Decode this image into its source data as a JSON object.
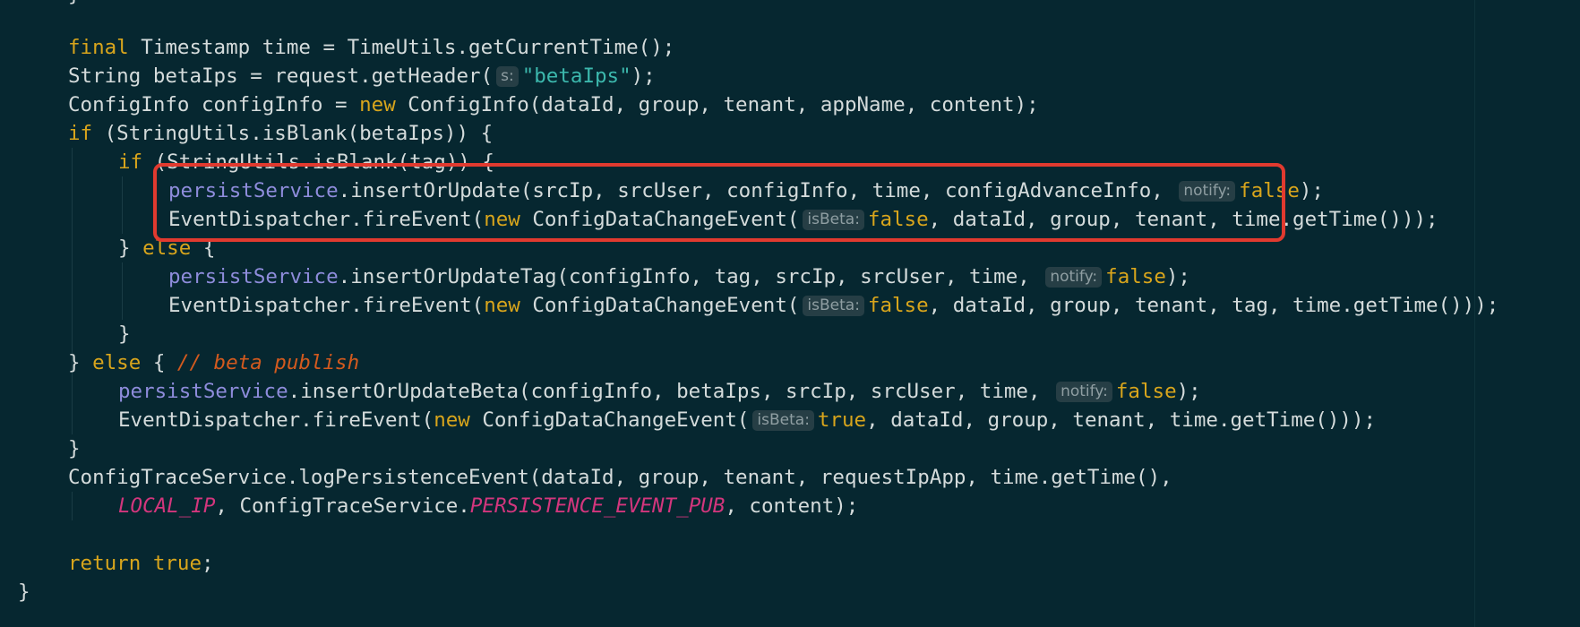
{
  "editor": {
    "top_fragment": "}",
    "lines": [
      {
        "tokens": [
          {
            "t": "final",
            "c": "kw"
          },
          {
            "t": " Timestamp time = TimeUtils.getCurrentTime();"
          }
        ]
      },
      {
        "tokens": [
          {
            "t": "String betaIps = request.getHeader("
          },
          {
            "t": "s:",
            "c": "hint"
          },
          {
            "t": "\"betaIps\"",
            "c": "str"
          },
          {
            "t": ");"
          }
        ]
      },
      {
        "tokens": [
          {
            "t": "ConfigInfo configInfo = "
          },
          {
            "t": "new",
            "c": "kw"
          },
          {
            "t": " ConfigInfo(dataId, group, tenant, appName, content);"
          }
        ]
      },
      {
        "tokens": [
          {
            "t": "if",
            "c": "kw"
          },
          {
            "t": " (StringUtils.isBlank(betaIps)) {"
          }
        ]
      },
      {
        "tokens": [
          {
            "t": "if",
            "c": "kw"
          },
          {
            "t": " (StringUtils.isBlank(tag)) {"
          }
        ]
      },
      {
        "tokens": [
          {
            "t": "persistService",
            "c": "field"
          },
          {
            "t": ".insertOrUpdate(srcIp, srcUser, configInfo, time, configAdvanceInfo, "
          },
          {
            "t": "notify:",
            "c": "hint"
          },
          {
            "t": "false",
            "c": "kw"
          },
          {
            "t": ");"
          }
        ]
      },
      {
        "tokens": [
          {
            "t": "EventDispatcher.fireEvent("
          },
          {
            "t": "new",
            "c": "kw"
          },
          {
            "t": " ConfigDataChangeEvent("
          },
          {
            "t": "isBeta:",
            "c": "hint"
          },
          {
            "t": "false",
            "c": "kw"
          },
          {
            "t": ", dataId, group, tenant, time.getTime()));"
          }
        ]
      },
      {
        "tokens": [
          {
            "t": "} "
          },
          {
            "t": "else",
            "c": "kw"
          },
          {
            "t": " {"
          }
        ]
      },
      {
        "tokens": [
          {
            "t": "persistService",
            "c": "field"
          },
          {
            "t": ".insertOrUpdateTag(configInfo, tag, srcIp, srcUser, time, "
          },
          {
            "t": "notify:",
            "c": "hint"
          },
          {
            "t": "false",
            "c": "kw"
          },
          {
            "t": ");"
          }
        ]
      },
      {
        "tokens": [
          {
            "t": "EventDispatcher.fireEvent("
          },
          {
            "t": "new",
            "c": "kw"
          },
          {
            "t": " ConfigDataChangeEvent("
          },
          {
            "t": "isBeta:",
            "c": "hint"
          },
          {
            "t": "false",
            "c": "kw"
          },
          {
            "t": ", dataId, group, tenant, tag, time.getTime()));"
          }
        ]
      },
      {
        "tokens": [
          {
            "t": "}"
          }
        ]
      },
      {
        "tokens": [
          {
            "t": "} "
          },
          {
            "t": "else",
            "c": "kw"
          },
          {
            "t": " { "
          },
          {
            "t": "// beta publish",
            "c": "comment"
          }
        ]
      },
      {
        "tokens": [
          {
            "t": "persistService",
            "c": "field"
          },
          {
            "t": ".insertOrUpdateBeta(configInfo, betaIps, srcIp, srcUser, time, "
          },
          {
            "t": "notify:",
            "c": "hint"
          },
          {
            "t": "false",
            "c": "kw"
          },
          {
            "t": ");"
          }
        ]
      },
      {
        "tokens": [
          {
            "t": "EventDispatcher.fireEvent("
          },
          {
            "t": "new",
            "c": "kw"
          },
          {
            "t": " ConfigDataChangeEvent("
          },
          {
            "t": "isBeta:",
            "c": "hint"
          },
          {
            "t": "true",
            "c": "kw"
          },
          {
            "t": ", dataId, group, tenant, time.getTime()));"
          }
        ]
      },
      {
        "tokens": [
          {
            "t": "}"
          }
        ]
      },
      {
        "tokens": [
          {
            "t": "ConfigTraceService.logPersistenceEvent(dataId, group, tenant, requestIpApp, time.getTime(),"
          }
        ]
      },
      {
        "tokens": [
          {
            "t": "LOCAL_IP",
            "c": "const"
          },
          {
            "t": ", ConfigTraceService."
          },
          {
            "t": "PERSISTENCE_EVENT_PUB",
            "c": "const"
          },
          {
            "t": ", content);"
          }
        ]
      },
      {
        "tokens": []
      },
      {
        "tokens": [
          {
            "t": "return",
            "c": "kw"
          },
          {
            "t": " "
          },
          {
            "t": "true",
            "c": "kw"
          },
          {
            "t": ";"
          }
        ]
      },
      {
        "tokens": [
          {
            "t": "}"
          }
        ]
      }
    ]
  },
  "theme": {
    "background": "#062730",
    "text": "#d4dbdb",
    "keyword": "#d8a51c",
    "string": "#3cb8ad",
    "field": "#8e8cdb",
    "constant": "#d3367d",
    "comment": "#d35a1e",
    "highlight_border": "#e13a2f"
  }
}
